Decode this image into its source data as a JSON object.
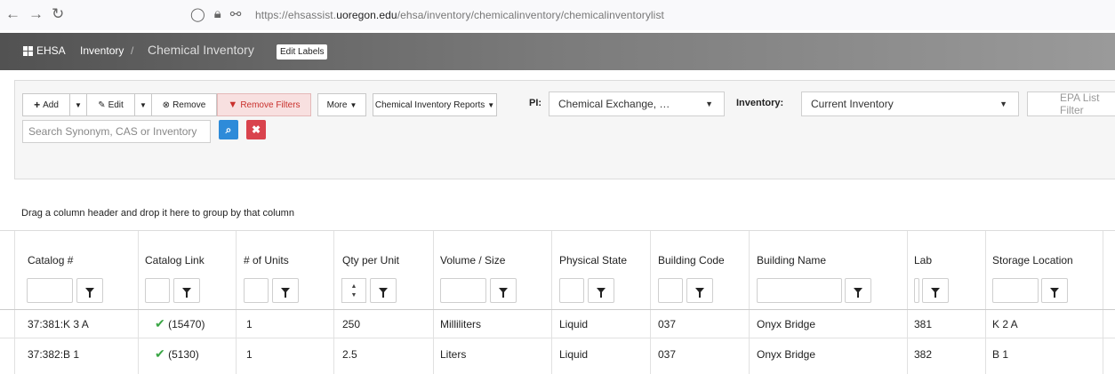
{
  "browser": {
    "url_prefix": "https://ehsassist.",
    "url_domain": "uoregon.edu",
    "url_path": "/ehsa/inventory/chemicalinventory/chemicalinventorylist"
  },
  "header": {
    "brand": "EHSA",
    "crumb_inventory": "Inventory",
    "crumb_sep": "/",
    "crumb_current": "Chemical Inventory",
    "edit_labels": "Edit Labels"
  },
  "toolbar": {
    "add": "Add",
    "edit": "Edit",
    "remove": "Remove",
    "remove_filters": "Remove Filters",
    "more": "More",
    "reports": "Chemical Inventory Reports",
    "pi_label": "PI:",
    "pi_value": "Chemical Exchange, …",
    "inventory_label": "Inventory:",
    "inventory_value": "Current Inventory",
    "epa_placeholder": "EPA List Filter",
    "search_placeholder": "Search Synonym, CAS or Inventory"
  },
  "grid": {
    "group_hint": "Drag a column header and drop it here to group by that column",
    "columns": [
      "Catalog #",
      "Catalog Link",
      "# of Units",
      "Qty per Unit",
      "Volume / Size",
      "Physical State",
      "Building Code",
      "Building Name",
      "Lab",
      "Storage Location"
    ],
    "rows": [
      {
        "catalog": "37:381:K 3 A",
        "link": "(15470)",
        "units": "1",
        "qty": "250",
        "volume": "Milliliters",
        "state": "Liquid",
        "bcode": "037",
        "bname": "Onyx Bridge",
        "lab": "381",
        "storage": "K 2 A"
      },
      {
        "catalog": "37:382:B 1",
        "link": "(5130)",
        "units": "1",
        "qty": "2.5",
        "volume": "Liters",
        "state": "Liquid",
        "bcode": "037",
        "bname": "Onyx Bridge",
        "lab": "382",
        "storage": "B 1"
      }
    ]
  }
}
